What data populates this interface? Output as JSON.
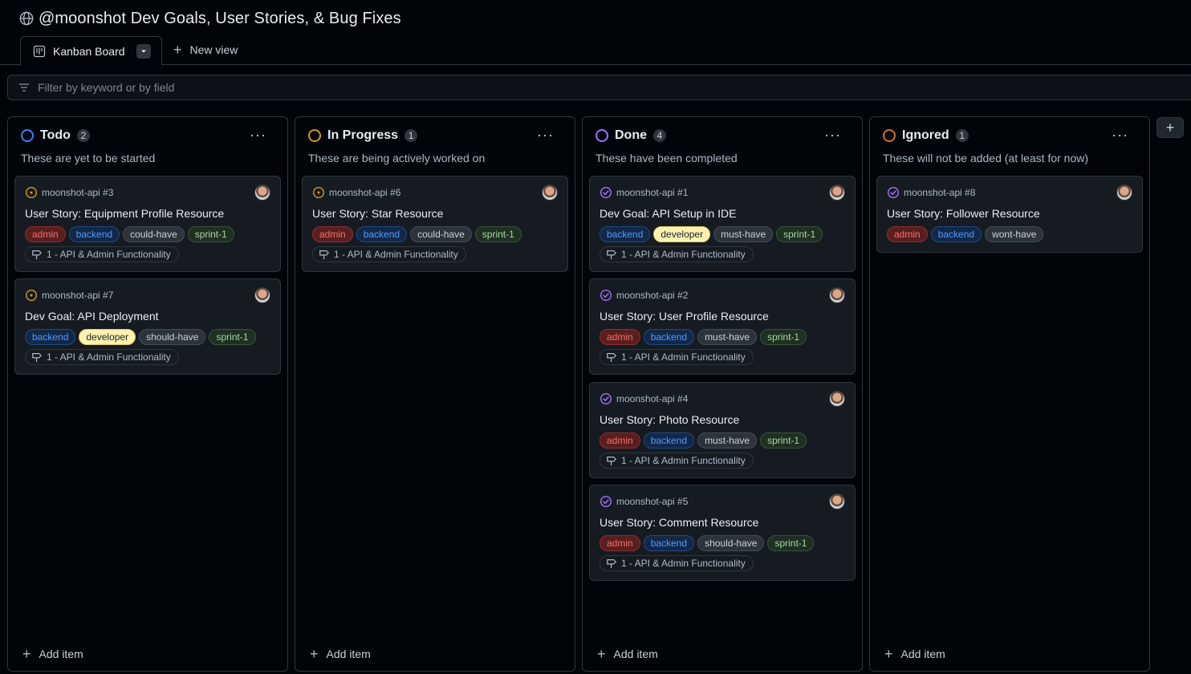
{
  "header": {
    "title": "@moonshot Dev Goals, User Stories, & Bug Fixes",
    "icon": "globe-icon"
  },
  "tabs": {
    "active_label": "Kanban Board",
    "new_view_label": "New view"
  },
  "filter": {
    "placeholder": "Filter by keyword or by field"
  },
  "colors": {
    "todo": "#2f81f7",
    "inprogress": "#d29922",
    "done": "#a371f7",
    "ignored": "#db6d28",
    "open_issue": "#d29922",
    "closed_issue": "#a371f7"
  },
  "label_colors": {
    "admin": {
      "text": "#f47067",
      "bg": "#5a1e1e",
      "border": "#8b2e2e"
    },
    "backend": {
      "text": "#539bf5",
      "bg": "#12284a",
      "border": "#1f4a82"
    },
    "could-have": {
      "text": "#c9d1d9",
      "bg": "#2d333b",
      "border": "#444c56"
    },
    "should-have": {
      "text": "#c9d1d9",
      "bg": "#2d333b",
      "border": "#444c56"
    },
    "must-have": {
      "text": "#c9d1d9",
      "bg": "#2d333b",
      "border": "#444c56"
    },
    "wont-have": {
      "text": "#c9d1d9",
      "bg": "#2d333b",
      "border": "#444c56"
    },
    "sprint-1": {
      "text": "#a6d7a3",
      "bg": "#1f2f22",
      "border": "#36553a"
    },
    "developer": {
      "text": "#1c2128",
      "bg": "#fff2b0",
      "border": "#e0c96a"
    }
  },
  "columns": [
    {
      "name": "Todo",
      "count": "2",
      "description": "These are yet to be started",
      "add_label": "Add item",
      "cards": [
        {
          "ref": "moonshot-api #3",
          "title": "User Story: Equipment Profile Resource",
          "state": "open",
          "labels": [
            "admin",
            "backend",
            "could-have",
            "sprint-1"
          ],
          "milestone": "1 - API & Admin Functionality"
        },
        {
          "ref": "moonshot-api #7",
          "title": "Dev Goal: API Deployment",
          "state": "open",
          "labels": [
            "backend",
            "developer",
            "should-have",
            "sprint-1"
          ],
          "milestone": "1 - API & Admin Functionality"
        }
      ]
    },
    {
      "name": "In Progress",
      "count": "1",
      "description": "These are being actively worked on",
      "add_label": "Add item",
      "cards": [
        {
          "ref": "moonshot-api #6",
          "title": "User Story: Star Resource",
          "state": "open",
          "labels": [
            "admin",
            "backend",
            "could-have",
            "sprint-1"
          ],
          "milestone": "1 - API & Admin Functionality"
        }
      ]
    },
    {
      "name": "Done",
      "count": "4",
      "description": "These have been completed",
      "add_label": "Add item",
      "cards": [
        {
          "ref": "moonshot-api #1",
          "title": "Dev Goal: API Setup in IDE",
          "state": "closed",
          "labels": [
            "backend",
            "developer",
            "must-have",
            "sprint-1"
          ],
          "milestone": "1 - API & Admin Functionality"
        },
        {
          "ref": "moonshot-api #2",
          "title": "User Story: User Profile Resource",
          "state": "closed",
          "labels": [
            "admin",
            "backend",
            "must-have",
            "sprint-1"
          ],
          "milestone": "1 - API & Admin Functionality"
        },
        {
          "ref": "moonshot-api #4",
          "title": "User Story: Photo Resource",
          "state": "closed",
          "labels": [
            "admin",
            "backend",
            "must-have",
            "sprint-1"
          ],
          "milestone": "1 - API & Admin Functionality"
        },
        {
          "ref": "moonshot-api #5",
          "title": "User Story: Comment Resource",
          "state": "closed",
          "labels": [
            "admin",
            "backend",
            "should-have",
            "sprint-1"
          ],
          "milestone": "1 - API & Admin Functionality"
        }
      ]
    },
    {
      "name": "Ignored",
      "count": "1",
      "description": "These will not be added (at least for now)",
      "add_label": "Add item",
      "cards": [
        {
          "ref": "moonshot-api #8",
          "title": "User Story: Follower Resource",
          "state": "closed",
          "labels": [
            "admin",
            "backend",
            "wont-have"
          ],
          "milestone": ""
        }
      ]
    }
  ]
}
